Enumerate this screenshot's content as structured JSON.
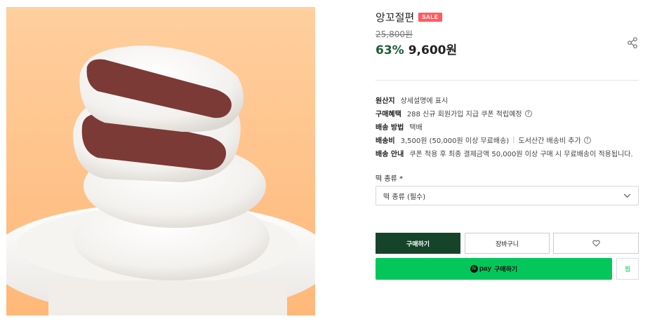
{
  "product": {
    "title": "앙꼬절편",
    "badge": "SALE",
    "original_price": "25,800원",
    "discount": "63%",
    "price": "9,600원"
  },
  "details": [
    {
      "label": "원산지",
      "value": "상세설명에 표시"
    },
    {
      "label": "구매혜택",
      "value": "288 신규 회원가입 지급 쿠폰 적립예정"
    },
    {
      "label": "배송 방법",
      "value": "택배"
    },
    {
      "label": "배송비",
      "value": "3,500원 (50,000원 이상 무료배송)",
      "extra": "도서산간 배송비 추가"
    },
    {
      "label": "배송 안내",
      "value": "쿠폰 적용 후 최종 결제금액 50,000원 이상 구매 시 무료배송이 적용됩니다."
    }
  ],
  "option": {
    "label": "떡 종류 *",
    "selected": "떡 종류 (필수)"
  },
  "buttons": {
    "buy": "구매하기",
    "cart": "장바구니",
    "npay_n": "N",
    "npay_word": "pay",
    "npay_buy": "구매하기",
    "npay_wish": "찜"
  },
  "colors": {
    "brand_green": "#16442a",
    "discount_green": "#1e5b38",
    "npay_green": "#03c75a",
    "sale_red": "#ff5a5f"
  },
  "icons": {
    "share": "share-icon",
    "help": "help-circle-icon",
    "dropdown": "chevron-down-icon",
    "wishlist": "heart-icon"
  }
}
